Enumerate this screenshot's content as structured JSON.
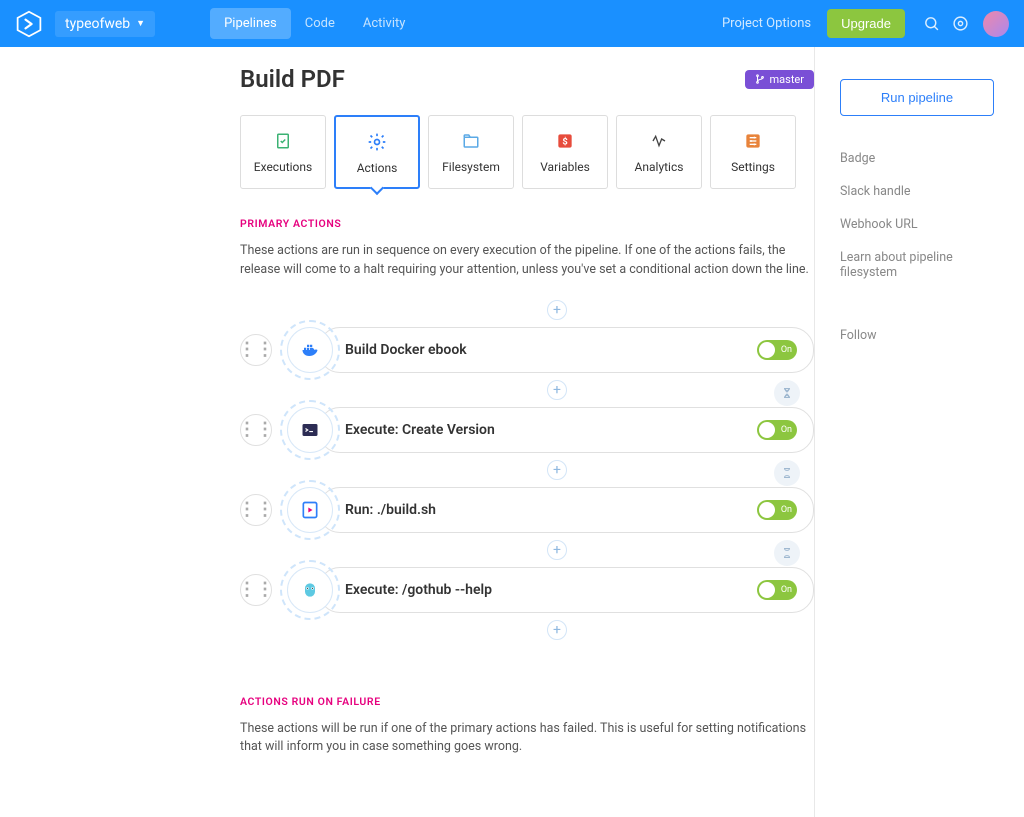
{
  "header": {
    "project": "typeofweb",
    "tabs": [
      {
        "label": "Pipelines",
        "active": true
      },
      {
        "label": "Code",
        "active": false
      },
      {
        "label": "Activity",
        "active": false
      }
    ],
    "project_options": "Project Options",
    "upgrade": "Upgrade"
  },
  "page": {
    "title": "Build PDF",
    "branch": "master"
  },
  "pipeline_tabs": [
    {
      "id": "executions",
      "label": "Executions",
      "icon": "check-doc-icon",
      "color": "#3bb273"
    },
    {
      "id": "actions",
      "label": "Actions",
      "icon": "gear-icon",
      "color": "#2d7ff9",
      "active": true
    },
    {
      "id": "filesystem",
      "label": "Filesystem",
      "icon": "folder-icon",
      "color": "#5aa9e6"
    },
    {
      "id": "variables",
      "label": "Variables",
      "icon": "dollar-icon",
      "color": "#e74c3c"
    },
    {
      "id": "analytics",
      "label": "Analytics",
      "icon": "pulse-icon",
      "color": "#444"
    },
    {
      "id": "settings",
      "label": "Settings",
      "icon": "sliders-icon",
      "color": "#e8833a"
    }
  ],
  "primary": {
    "heading": "PRIMARY ACTIONS",
    "desc": "These actions are run in sequence on every execution of the pipeline. If one of the actions fails, the release will come to a halt requiring your attention, unless you've set a conditional action down the line."
  },
  "actions": [
    {
      "name": "Build Docker ebook",
      "toggle": "On",
      "icon": "docker-icon",
      "color": "#2d7ff9"
    },
    {
      "name": "Execute: Create Version",
      "toggle": "On",
      "icon": "terminal-icon",
      "color": "#2c2c54"
    },
    {
      "name": "Run: ./build.sh",
      "toggle": "On",
      "icon": "play-file-icon",
      "color": "#2d7ff9"
    },
    {
      "name": "Execute: /gothub --help",
      "toggle": "On",
      "icon": "gopher-icon",
      "color": "#5dc9e2"
    }
  ],
  "failure": {
    "heading": "ACTIONS RUN ON FAILURE",
    "desc": "These actions will be run if one of the primary actions has failed. This is useful for setting notifications that will inform you in case something goes wrong."
  },
  "sidebar": {
    "run": "Run pipeline",
    "links": [
      "Badge",
      "Slack handle",
      "Webhook URL",
      "Learn about pipeline filesystem"
    ],
    "follow": "Follow"
  }
}
